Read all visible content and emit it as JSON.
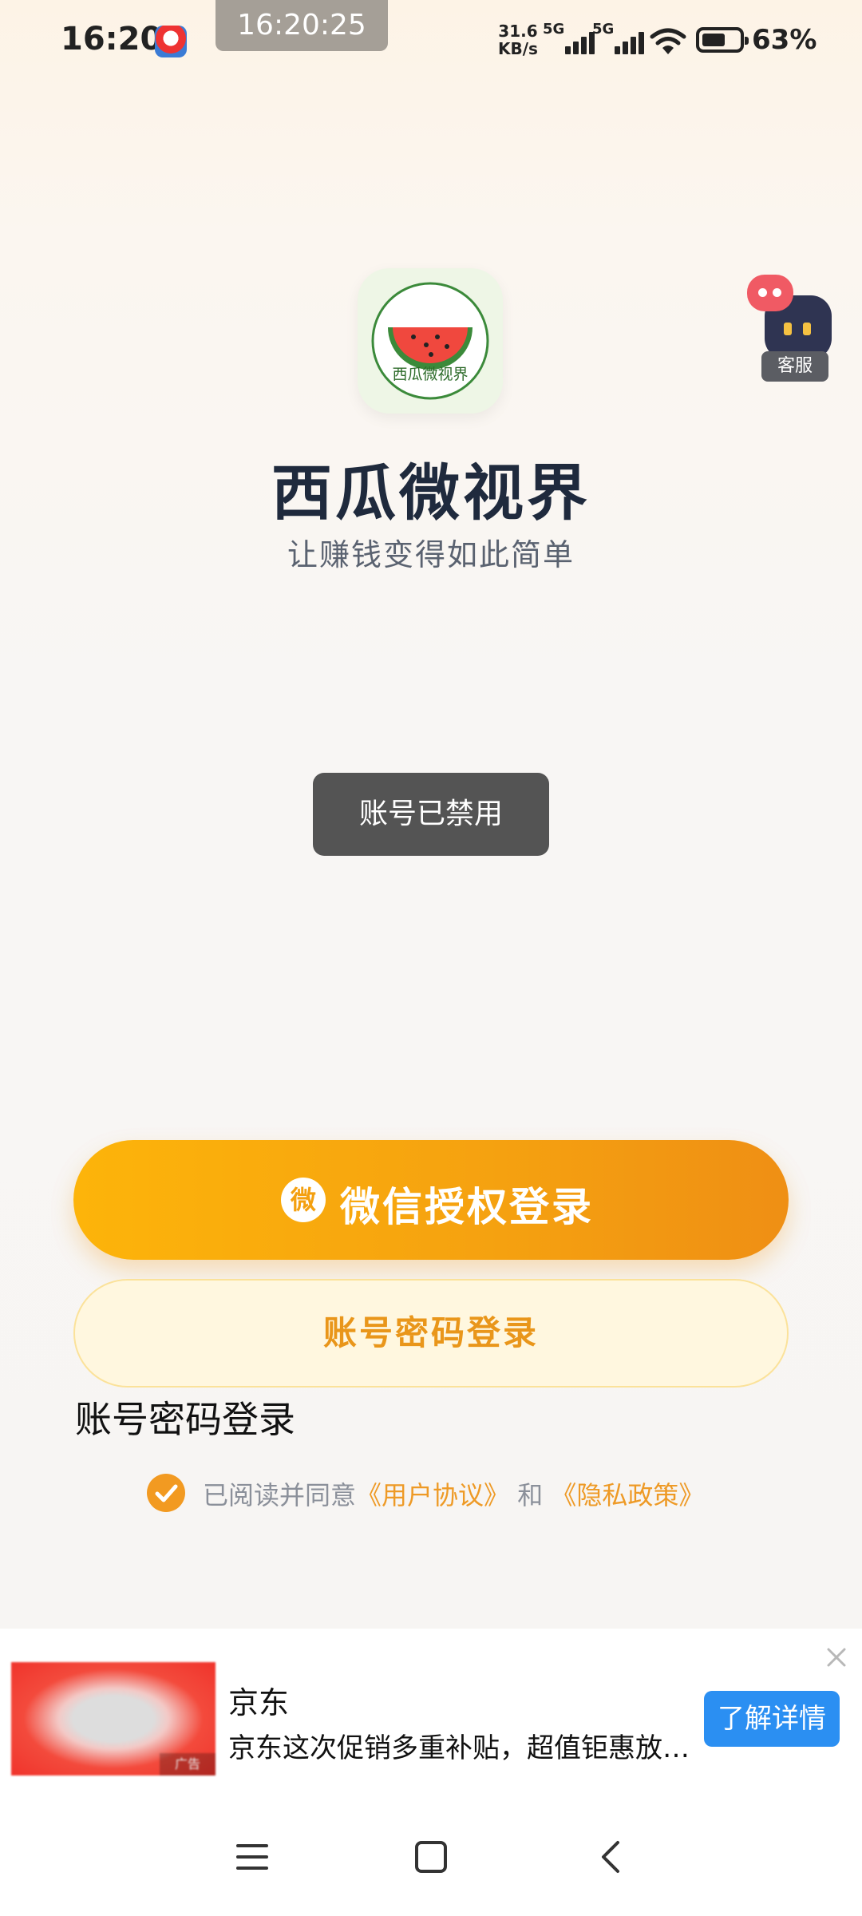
{
  "status_bar": {
    "time": "16:20",
    "clock_pill": "16:20:25",
    "net_speed": "31.6",
    "net_unit": "KB/s",
    "sim1": "5G",
    "sim2": "5G",
    "battery": "63%",
    "battery_level": 0.63
  },
  "app": {
    "logo_text": "西瓜微视界",
    "name": "西瓜微视界",
    "slogan": "让赚钱变得如此简单"
  },
  "customer_service": {
    "label": "客服"
  },
  "toast": {
    "message": "账号已禁用"
  },
  "login": {
    "wechat_icon": "微",
    "wechat_label": "微信授权登录",
    "password_button_label": "账号密码登录",
    "password_text": "账号密码登录"
  },
  "agreement": {
    "prefix": "已阅读并同意",
    "user_agreement": "《用户协议》",
    "and": "和",
    "privacy_policy": "《隐私政策》",
    "checked": true
  },
  "ad": {
    "brand": "京东",
    "description": "京东这次促销多重补贴，超值钜惠放…",
    "cta": "了解详情",
    "tag": "广告"
  },
  "nav": {
    "menu_icon": "menu-icon",
    "home_icon": "home-icon",
    "back_icon": "back-icon"
  },
  "colors": {
    "accent": "#f5a110",
    "title": "#1f2a3d",
    "toast_bg": "#545454",
    "ad_cta": "#2b8ff2"
  }
}
